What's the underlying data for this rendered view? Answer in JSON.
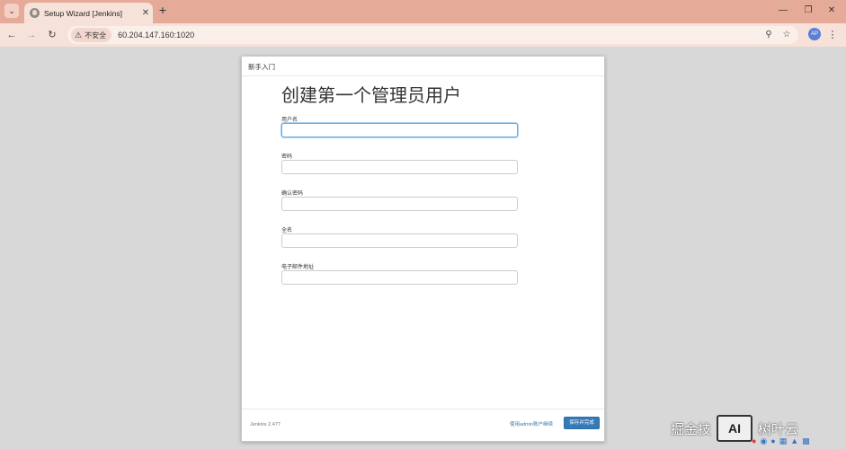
{
  "browser": {
    "tab_title": "Setup Wizard [Jenkins]",
    "security_label": "不安全",
    "url": "60.204.147.160:1020",
    "profile_initials": "AP"
  },
  "icons": {
    "tab_menu": "chevron-down-icon",
    "favicon": "jenkins-icon",
    "tab_close": "close-icon",
    "new_tab": "plus-icon",
    "minimize": "minimize-icon",
    "maximize": "restore-icon",
    "window_close": "close-icon",
    "back": "arrow-left-icon",
    "forward": "arrow-right-icon",
    "reload": "reload-icon",
    "security": "warning-icon",
    "zoom": "zoom-icon",
    "bookmark": "star-icon",
    "menu": "kebab-icon"
  },
  "dialog": {
    "header": "新手入门",
    "title": "创建第一个管理员用户",
    "fields": [
      {
        "label": "用户名",
        "value": ""
      },
      {
        "label": "密码",
        "value": ""
      },
      {
        "label": "确认密码",
        "value": ""
      },
      {
        "label": "全名",
        "value": ""
      },
      {
        "label": "电子邮件地址",
        "value": ""
      }
    ],
    "version": "Jenkins 2.477",
    "skip_link": "使用admin账户继续",
    "save_button": "保存并完成"
  },
  "watermark": {
    "text_left": "掘金技",
    "logo": "AI",
    "text_right": "树叶云"
  },
  "colors": {
    "tab_strip": "#e6aa98",
    "toolbar": "#f7e2da",
    "primary_button": "#337ab7",
    "focus_border": "#66afe9"
  }
}
